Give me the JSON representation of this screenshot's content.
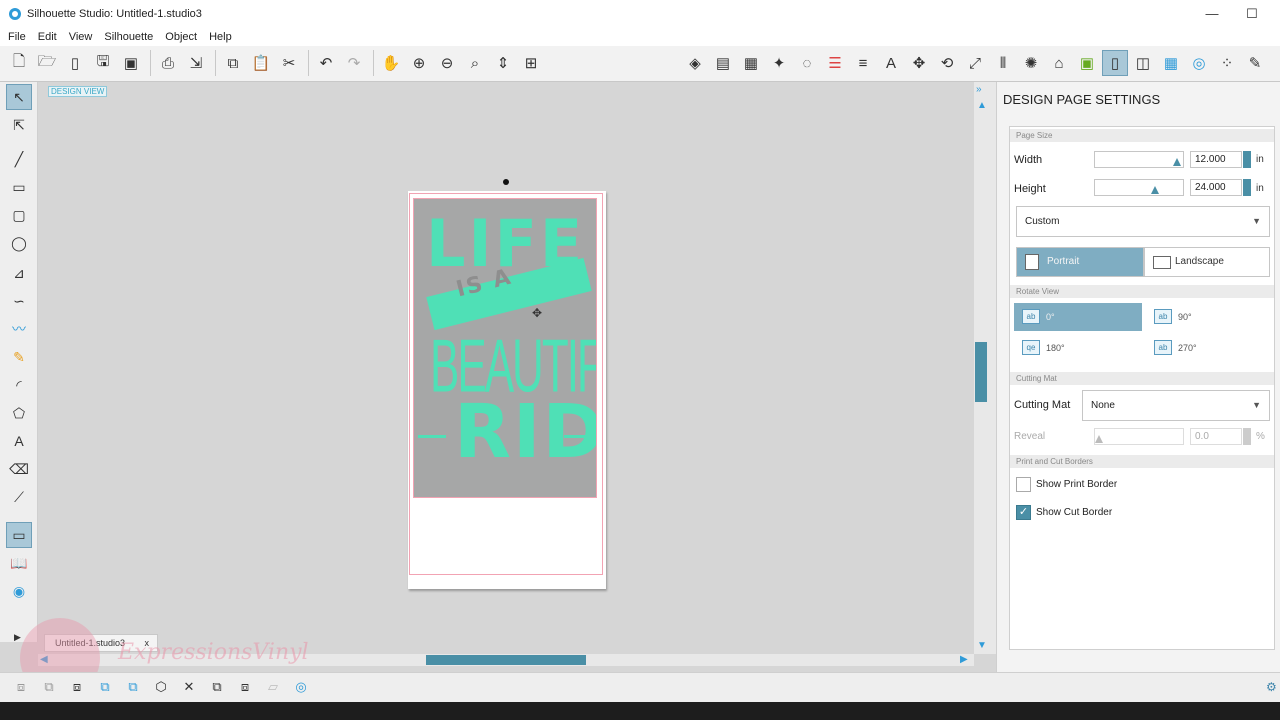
{
  "window": {
    "title": "Silhouette Studio: Untitled-1.studio3"
  },
  "menu": [
    "File",
    "Edit",
    "View",
    "Silhouette",
    "Object",
    "Help"
  ],
  "icons": {
    "window": [
      "minimize-icon",
      "maximize-icon"
    ],
    "toolbar_left": [
      "new-icon",
      "open-icon",
      "new-page-icon",
      "save-icon",
      "save-to-library-icon",
      "print-icon",
      "print-and-cut-icon",
      "copy-icon",
      "paste-icon",
      "cut-icon",
      "undo-icon",
      "redo-icon",
      "pan-icon",
      "zoom-in-icon",
      "zoom-out-icon",
      "zoom-selected-icon",
      "drag-zoom-icon",
      "fit-to-page-icon"
    ],
    "toolbar_right": [
      "fill-color-icon",
      "gradient-icon",
      "fill-pattern-icon",
      "line-color-icon",
      "line-style-icon",
      "align-icon",
      "text-style-icon",
      "transform-icon",
      "rotate-icon",
      "scale-icon",
      "move-icon",
      "replicate-icon",
      "modify-icon",
      "offset-icon",
      "trace-icon",
      "page-setup-icon",
      "cut-settings-icon",
      "grid-icon",
      "registration-icon",
      "library-icon",
      "store-icon"
    ],
    "left_tools": [
      "select-icon",
      "point-edit-icon",
      "line-icon",
      "rectangle-icon",
      "rounded-rectangle-icon",
      "ellipse-icon",
      "polygon-icon",
      "curve-icon",
      "freehand-icon",
      "pencil-icon",
      "arc-icon",
      "regular-polygon-icon",
      "text-icon",
      "eraser-icon",
      "knife-icon",
      "design-view-icon",
      "library-view-icon",
      "store-view-icon"
    ],
    "bottom_tools": [
      "group-icon",
      "ungroup-icon",
      "compound-path-icon",
      "release-compound-icon",
      "duplicate-icon",
      "delete-icon",
      "bring-to-front-icon",
      "send-to-back-icon",
      "layers-icon",
      "send-to-silhouette-icon"
    ]
  },
  "canvas": {
    "design_view_label": "DESIGN VIEW",
    "design_words": {
      "life": "LIFE",
      "is_a": "IS A",
      "beautiful": "BEAUTIFUL",
      "ride": "RIDE"
    },
    "doc_tab": "Untitled-1.studio3",
    "doc_tab_close": "x",
    "watermark": "ExpressionsVinyl",
    "accent_color": "#4fe0b6"
  },
  "panel": {
    "title": "DESIGN PAGE SETTINGS",
    "page_size": {
      "header": "Page Size",
      "width_label": "Width",
      "width_value": "12.000",
      "width_slider_fraction": 0.95,
      "height_label": "Height",
      "height_value": "24.000",
      "height_slider_fraction": 0.68,
      "unit": "in",
      "preset": "Custom",
      "orientation": [
        {
          "label": "Portrait",
          "selected": true
        },
        {
          "label": "Landscape",
          "selected": false
        }
      ]
    },
    "rotate_view": {
      "header": "Rotate View",
      "options": [
        {
          "label": "0°",
          "selected": true
        },
        {
          "label": "90°",
          "selected": false
        },
        {
          "label": "180°",
          "selected": false
        },
        {
          "label": "270°",
          "selected": false
        }
      ]
    },
    "cutting_mat": {
      "header": "Cutting Mat",
      "label": "Cutting Mat",
      "value": "None",
      "reveal_label": "Reveal",
      "reveal_value": "0.0",
      "reveal_unit": "%"
    },
    "borders": {
      "header": "Print and Cut Borders",
      "show_print_border": {
        "label": "Show Print Border",
        "checked": false
      },
      "show_cut_border": {
        "label": "Show Cut Border",
        "checked": true
      }
    }
  },
  "colors": {
    "accent": "#4a8fa6",
    "selected_bg": "#7fadc2",
    "cut_border": "#f2a3b3"
  }
}
